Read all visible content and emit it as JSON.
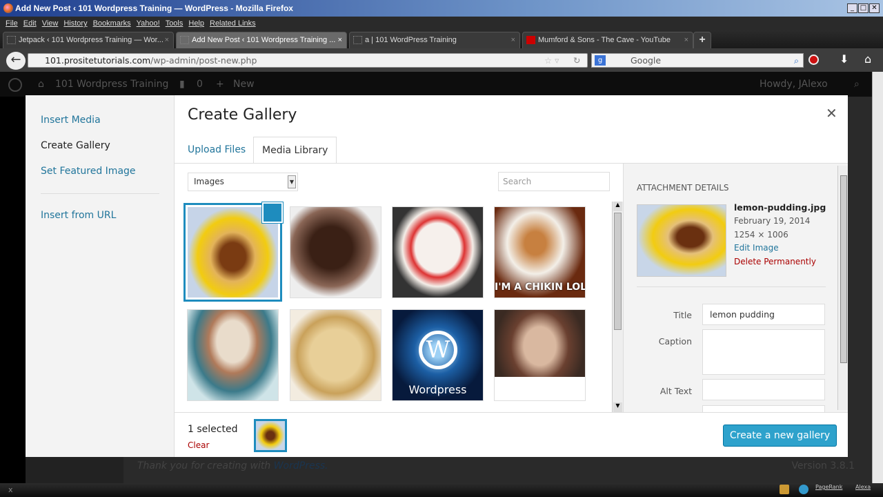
{
  "window": {
    "title": "Add New Post ‹ 101 Wordpress Training — WordPress - Mozilla Firefox"
  },
  "menu": [
    "File",
    "Edit",
    "View",
    "History",
    "Bookmarks",
    "Yahoo!",
    "Tools",
    "Help",
    "Related Links"
  ],
  "tabs": [
    {
      "label": "Jetpack ‹ 101 Wordpress Training — Wor..."
    },
    {
      "label": "Add New Post ‹ 101 Wordpress Training ..."
    },
    {
      "label": "a | 101 WordPress Training"
    },
    {
      "label": "Mumford & Sons - The Cave - YouTube"
    }
  ],
  "nav": {
    "url_domain": "101.prositetutorials.com",
    "url_path": "/wp-admin/post-new.php",
    "search_placeholder": "Google"
  },
  "adminbar": {
    "site": "101 Wordpress Training",
    "comments": "0",
    "new": "New",
    "howdy": "Howdy, JAlexo"
  },
  "modal": {
    "menu": [
      "Insert Media",
      "Create Gallery",
      "Set Featured Image",
      "Insert from URL"
    ],
    "title": "Create Gallery",
    "tabs": [
      "Upload Files",
      "Media Library"
    ],
    "filter": "Images",
    "search_placeholder": "Search",
    "images": [
      {
        "name": "lemon-pudding",
        "caption": ""
      },
      {
        "name": "chocolate-cake",
        "caption": ""
      },
      {
        "name": "strawberry-cake",
        "caption": ""
      },
      {
        "name": "chicken-cat",
        "caption": "I'M A CHIKIN LOL"
      },
      {
        "name": "ice-cream-sundae",
        "caption": ""
      },
      {
        "name": "ice-cream-scoop",
        "caption": ""
      },
      {
        "name": "wordpress-logo",
        "caption": "Wordpress"
      },
      {
        "name": "man-portrait",
        "caption": ""
      }
    ],
    "details": {
      "heading": "ATTACHMENT DETAILS",
      "filename": "lemon-pudding.jpg",
      "date": "February 19, 2014",
      "dimensions": "1254 × 1006",
      "edit": "Edit Image",
      "delete": "Delete Permanently",
      "title_label": "Title",
      "title_value": "lemon pudding",
      "caption_label": "Caption",
      "alt_label": "Alt Text"
    },
    "selected": "1 selected",
    "clear": "Clear",
    "create_button": "Create a new gallery"
  },
  "footer": {
    "thanks": "Thank you for creating with ",
    "wp": "WordPress.",
    "version": "Version 3.8.1"
  },
  "statusbar": {
    "close": "x",
    "pagerank": "PageRank",
    "alexa": "Alexa"
  }
}
